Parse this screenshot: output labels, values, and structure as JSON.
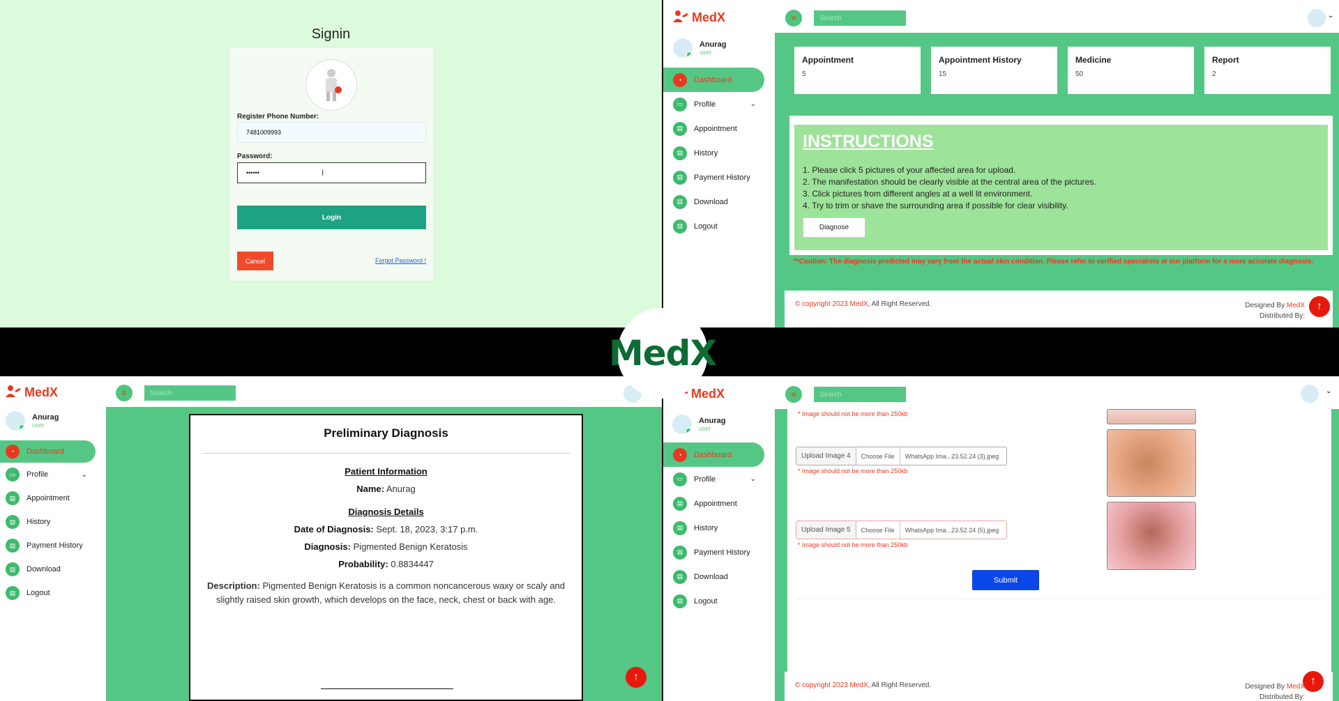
{
  "signin": {
    "title": "Signin",
    "phone_label": "Register Phone Number:",
    "phone_value": "7481009993",
    "password_label": "Password:",
    "password_value": "••••••",
    "login_label": "Login",
    "cancel_label": "Cancel",
    "forgot_label": "Forgot Password !"
  },
  "center_logo": "MedX",
  "app": {
    "brand": "MedX",
    "search_placeholder": "Search",
    "user_name": "Anurag",
    "user_role": "user",
    "menu": [
      "Dashboard",
      "Profile",
      "Appointment",
      "History",
      "Payment History",
      "Download",
      "Logout"
    ]
  },
  "dashboard": {
    "stats": [
      {
        "title": "Appointment",
        "value": "5"
      },
      {
        "title": "Appointment History",
        "value": "15"
      },
      {
        "title": "Medicine",
        "value": "50"
      },
      {
        "title": "Report",
        "value": "2"
      }
    ],
    "instructions_title": "INSTRUCTIONS",
    "instructions": [
      "1. Please click 5 pictures of your affected area for upload.",
      "2. The manifestation should be clearly visible at the central area of the pictures.",
      "3. Click pictures from different angles at a well lit environment.",
      "4. Try to trim or shave the surrounding area if possible for clear visibility."
    ],
    "diagnose_label": "Diagnose",
    "caution": "**Caution: The diagnosis predicted may vary from the actual skin condition. Please refer to verified specialists at our platform for a more accurate diagnosis.",
    "footer_copy_prefix": "© copyright 2023 MedX",
    "footer_copy_suffix": ", All Right Reserved.",
    "designed_prefix": "Designed By ",
    "designed_brand": "MedX",
    "distributed": "Distributed By:"
  },
  "diagnosis": {
    "title": "Preliminary Diagnosis",
    "patient_info": "Patient Information",
    "name_label": "Name:",
    "name_value": "Anurag",
    "details_title": "Diagnosis Details",
    "date_label": "Date of Diagnosis:",
    "date_value": "Sept. 18, 2023, 3:17 p.m.",
    "diagnosis_label": "Diagnosis:",
    "diagnosis_value": "Pigmented Benign Keratosis",
    "probability_label": "Probability:",
    "probability_value": "0.8834447",
    "description_label": "Description:",
    "description_value": "Pigmented Benign Keratosis is a common noncancerous waxy or scaly and slightly raised skin growth, which develops on the face, neck, chest or back with age."
  },
  "upload": {
    "warning": "* Image should not be more than 250kb",
    "rows": [
      {
        "label": "Upload Image 4",
        "button": "Choose File",
        "file": "WhatsApp Ima...23.52.24 (3).jpeg"
      },
      {
        "label": "Upload Image 5",
        "button": "Choose File",
        "file": "WhatsApp Ima...23.52.24 (5).jpeg"
      }
    ],
    "submit_label": "Submit"
  }
}
